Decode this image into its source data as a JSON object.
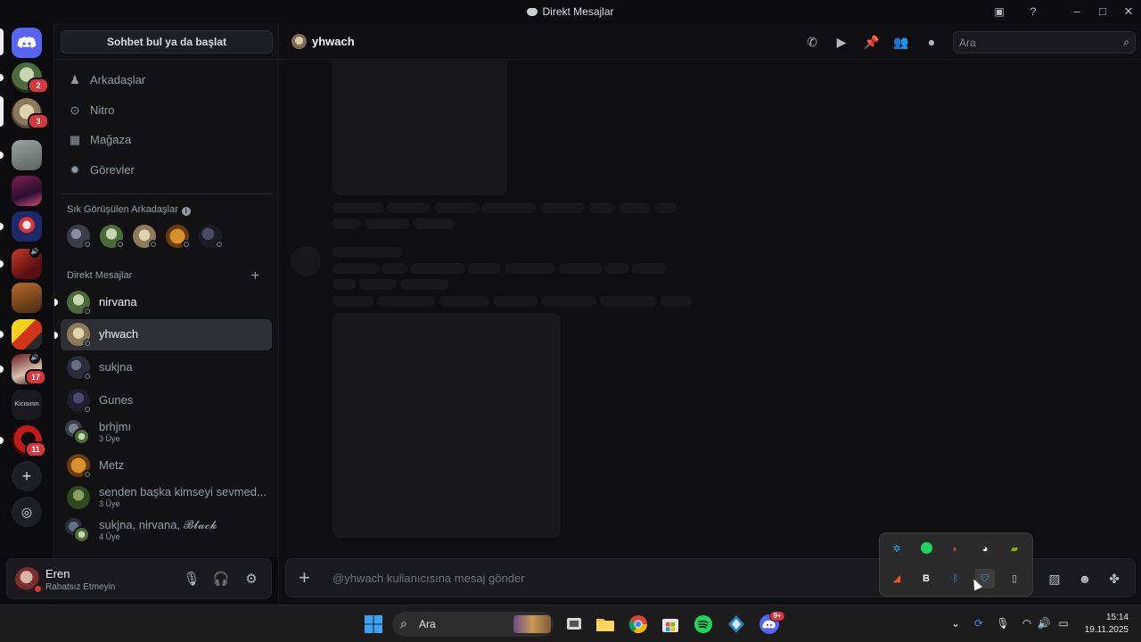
{
  "window": {
    "title": "Direkt Mesajlar"
  },
  "sidebar": {
    "search_button": "Sohbet bul ya da başlat",
    "nav": [
      {
        "label": "Arkadaşlar",
        "icon": "friends-icon"
      },
      {
        "label": "Nitro",
        "icon": "nitro-icon"
      },
      {
        "label": "Mağaza",
        "icon": "shop-icon"
      },
      {
        "label": "Görevler",
        "icon": "quests-icon"
      }
    ],
    "frequent_title": "Sık Görüşülen Arkadaşlar",
    "dm_title": "Direkt Mesajlar",
    "dms": [
      {
        "name": "nirvana",
        "sub": ""
      },
      {
        "name": "yhwach",
        "sub": ""
      },
      {
        "name": "sukjna",
        "sub": ""
      },
      {
        "name": "Gunes",
        "sub": ""
      },
      {
        "name": "brhjmı",
        "sub": "3 Üye"
      },
      {
        "name": "Metz",
        "sub": ""
      },
      {
        "name": "senden başka kimseyi sevmed...",
        "sub": "3 Üye"
      },
      {
        "name": "sukjna, nirvana, 𝓑𝓵𝓪𝓬𝓴",
        "sub": "4 Üye"
      }
    ]
  },
  "rail": {
    "badges": [
      "2",
      "3",
      "17",
      "11"
    ],
    "text_server": "Kıcısının"
  },
  "user": {
    "name": "Eren",
    "status": "Rahatsız Etmeyin"
  },
  "channel": {
    "name": "yhwach",
    "search_placeholder": "Ara",
    "composer_placeholder": "@yhwach kullanıcısına mesaj gönder"
  },
  "taskbar": {
    "search_label": "Ara",
    "discord_badge": "9+",
    "time": "15:14",
    "date": "19.11.2025"
  },
  "colors": {
    "accent": "#5865f2",
    "danger": "#da373c",
    "spotify": "#1ed760"
  }
}
